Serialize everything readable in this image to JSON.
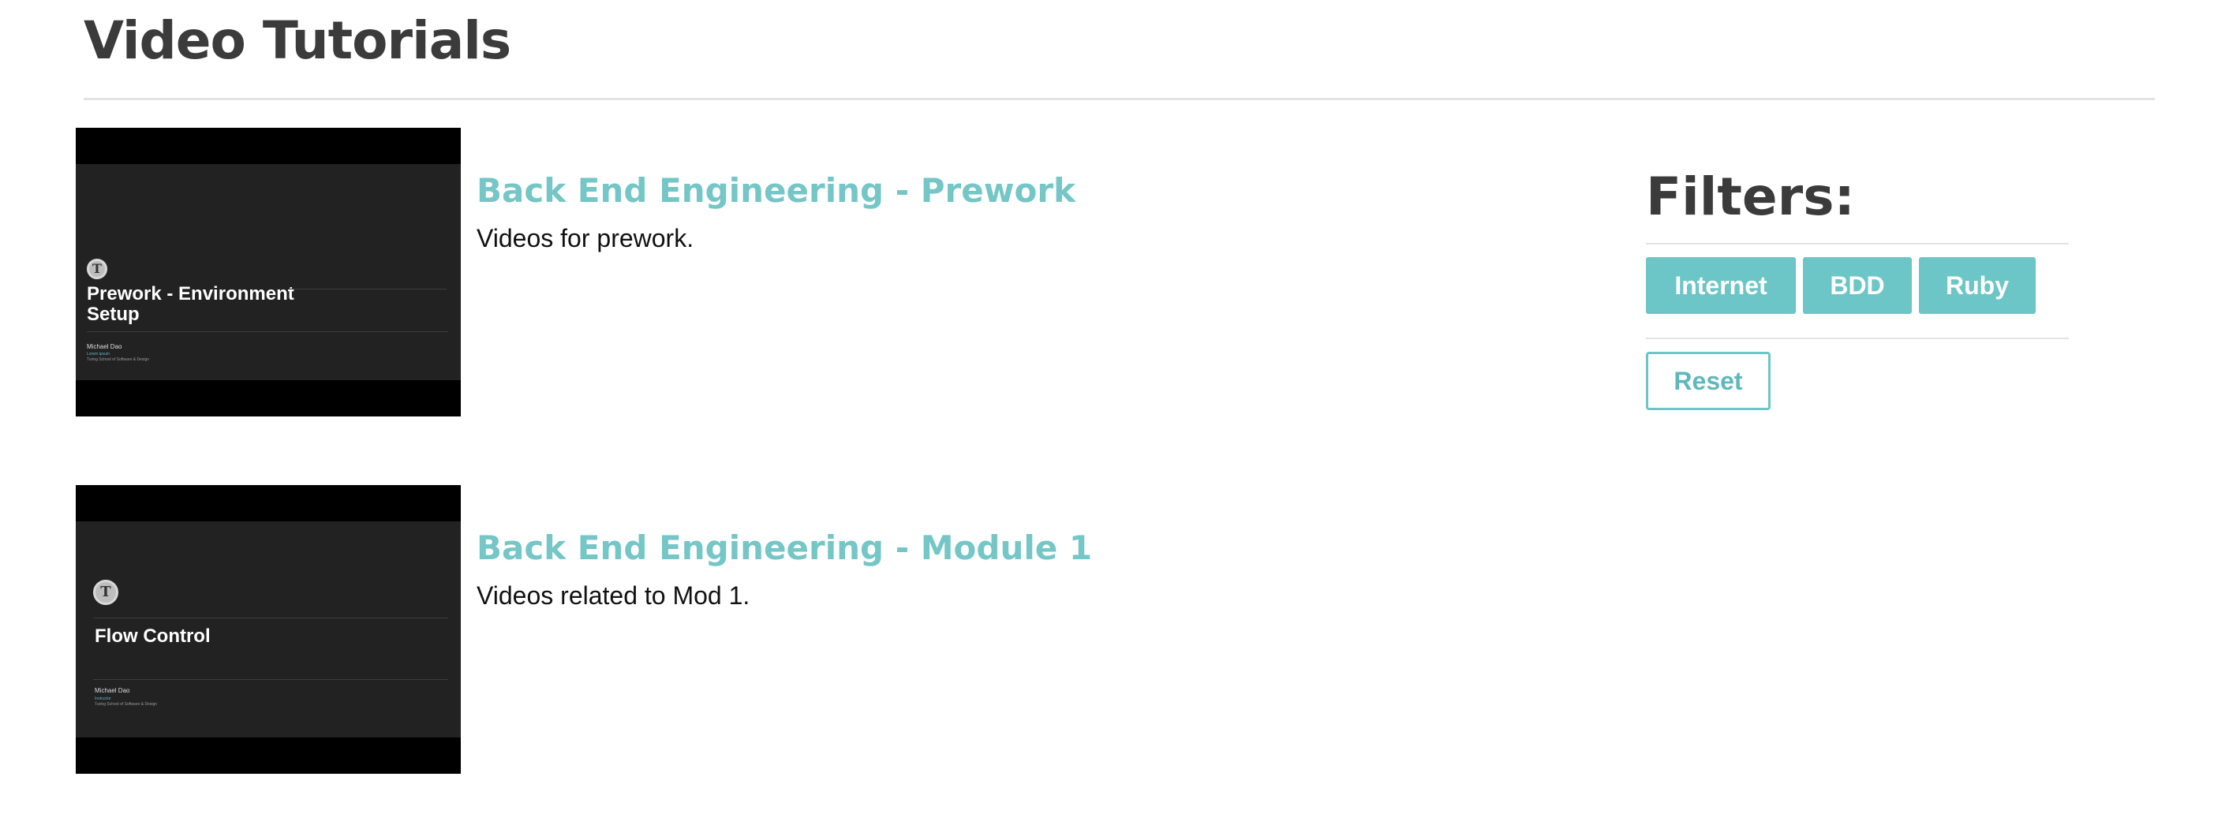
{
  "page": {
    "title": "Video Tutorials"
  },
  "videos": [
    {
      "title": "Back End Engineering - Prework",
      "description": "Videos for prework.",
      "thumbnail": {
        "slide_title": "Prework - Environment Setup",
        "author": "Michael Dao",
        "line1": "Lorem ipsum",
        "line2": "Turing School of Software & Design"
      }
    },
    {
      "title": "Back End Engineering - Module 1",
      "description": "Videos related to Mod 1.",
      "thumbnail": {
        "slide_title": "Flow Control",
        "author": "Michael Dao",
        "line1": "Instructor",
        "line2": "Turing School of Software & Design"
      }
    }
  ],
  "filters": {
    "title": "Filters:",
    "tags": [
      "Internet",
      "BDD",
      "Ruby"
    ],
    "reset_label": "Reset"
  },
  "colors": {
    "accent": "#6cc6c7",
    "heading": "#3b3b3b",
    "thumbnail_bg": "#222222"
  }
}
